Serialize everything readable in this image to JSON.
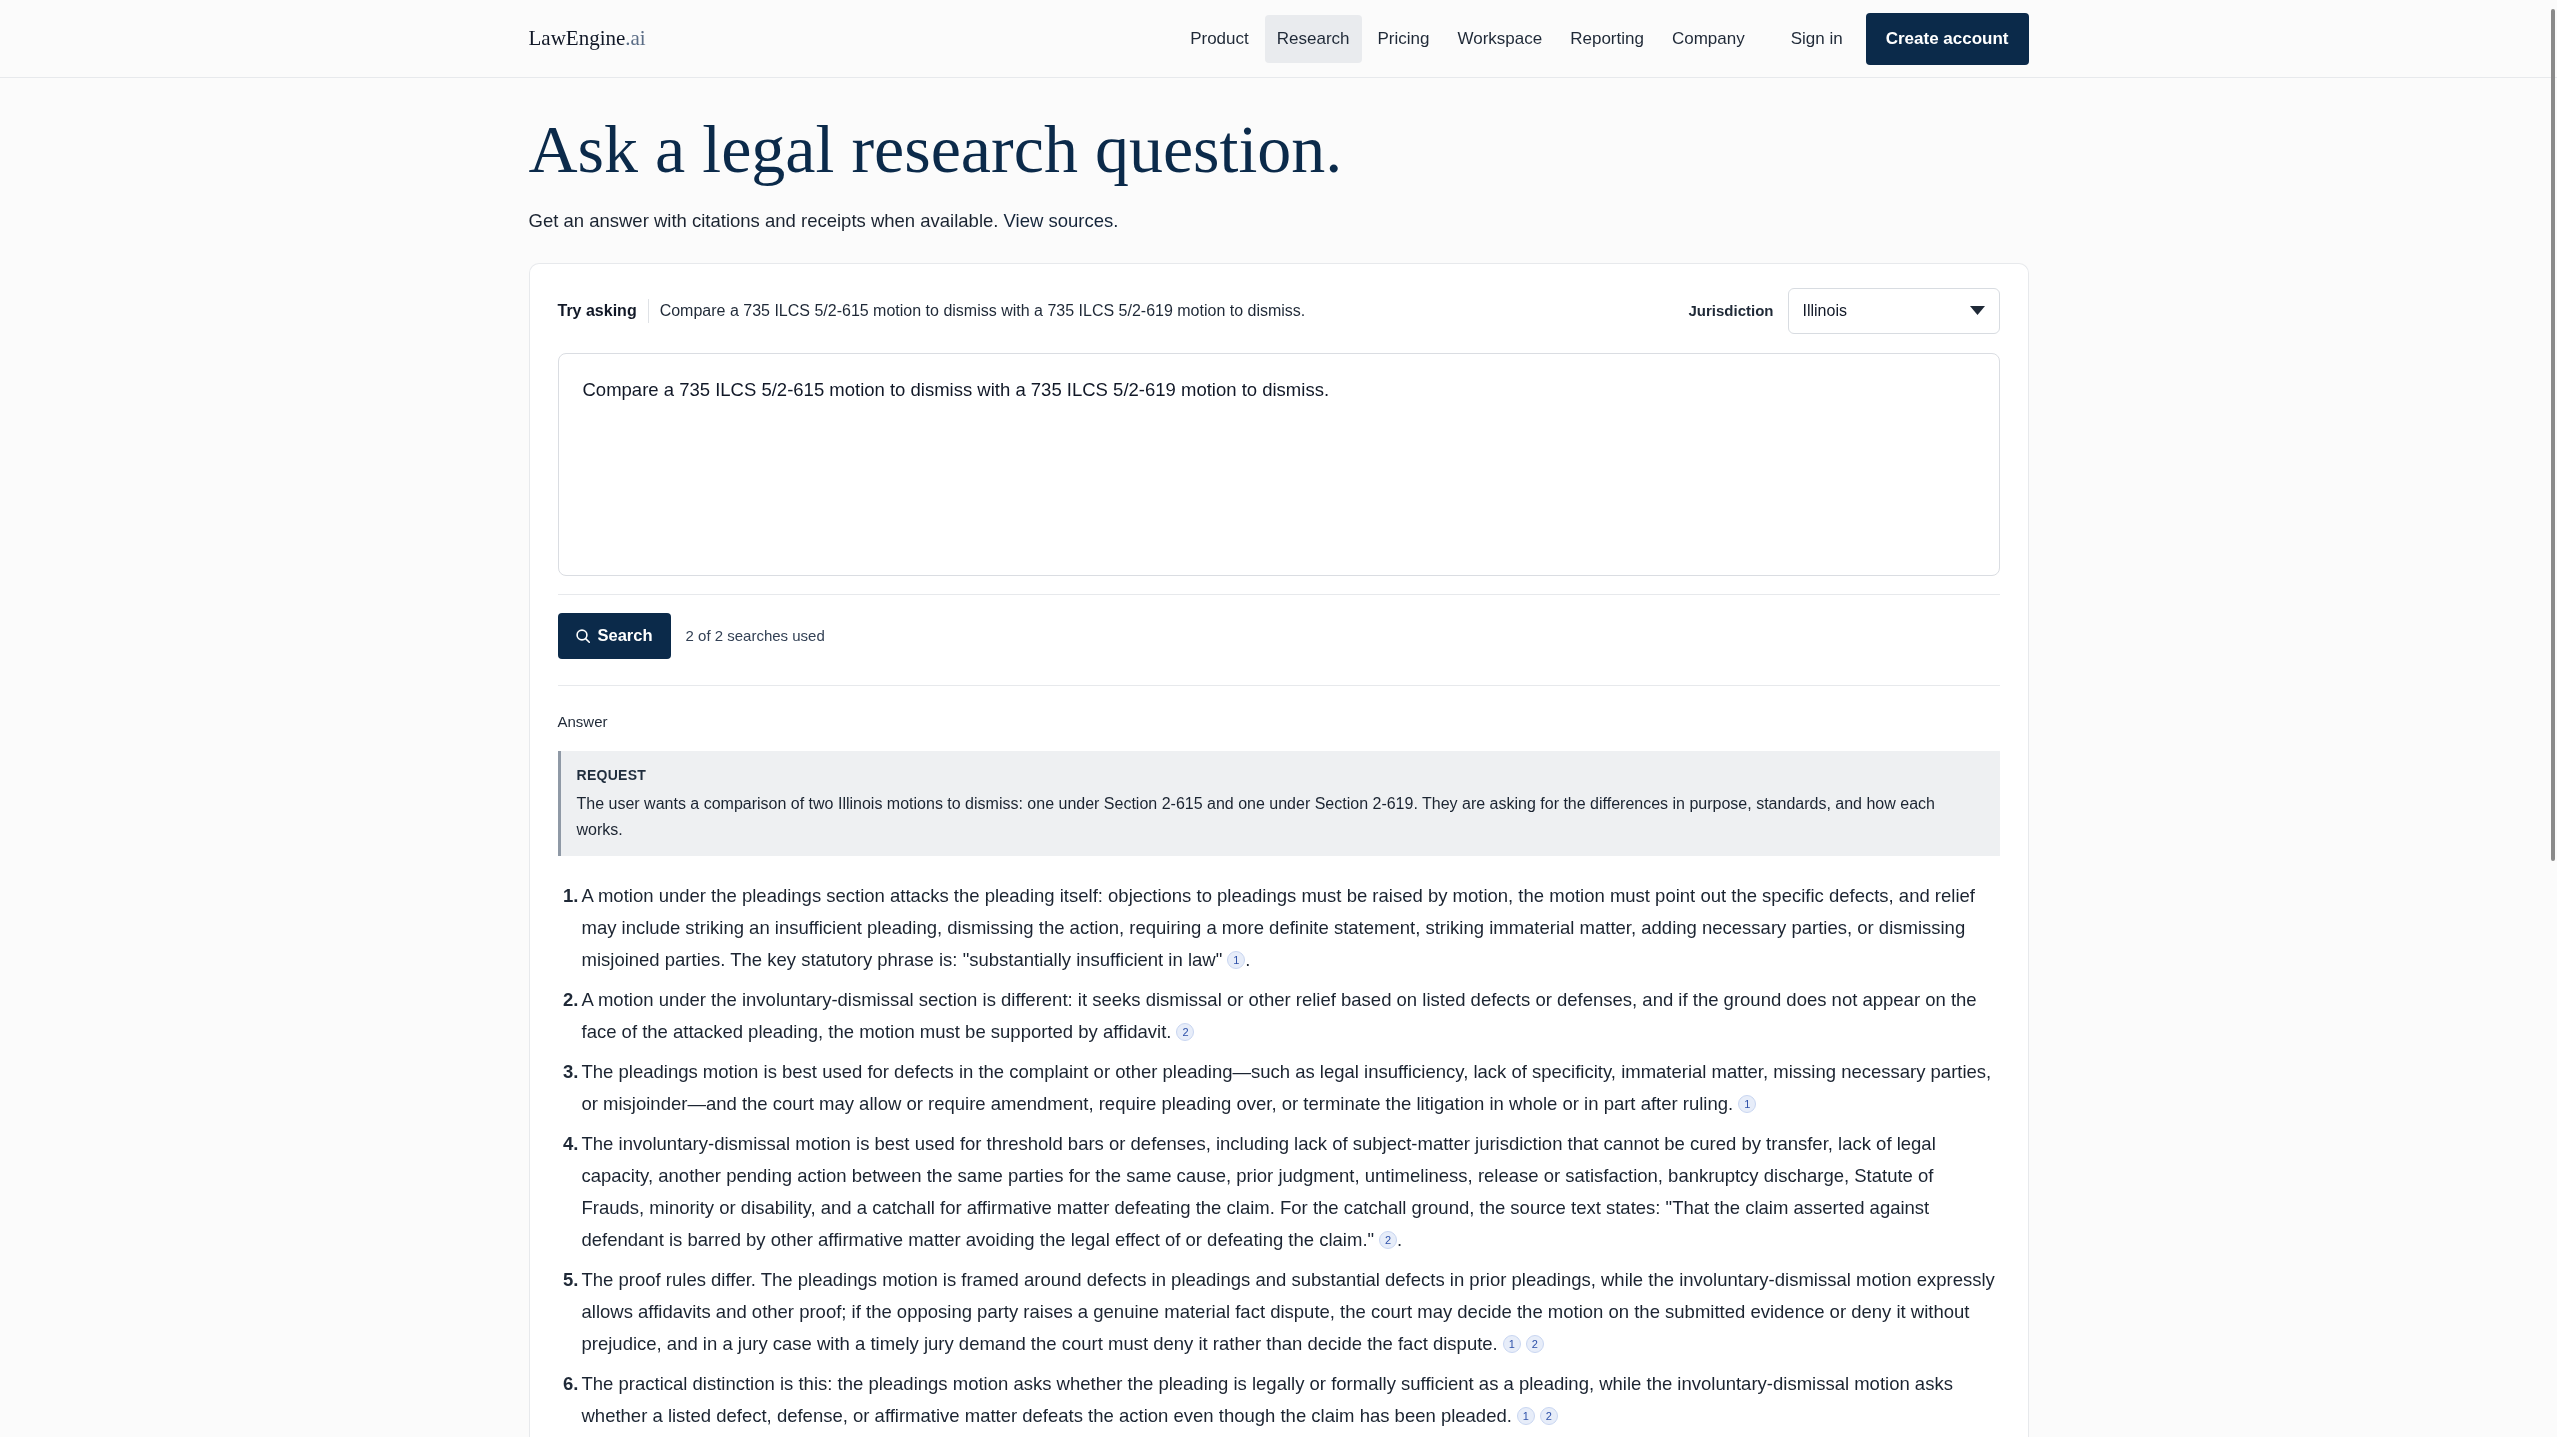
{
  "header": {
    "logo": {
      "name": "LawEngine",
      "suffix": ".ai"
    },
    "nav": [
      {
        "label": "Product",
        "selected": false
      },
      {
        "label": "Research",
        "selected": true
      },
      {
        "label": "Pricing",
        "selected": false
      },
      {
        "label": "Workspace",
        "selected": false
      },
      {
        "label": "Reporting",
        "selected": false
      },
      {
        "label": "Company",
        "selected": false
      }
    ],
    "sign_in": "Sign in",
    "create_account": "Create account"
  },
  "hero": {
    "title": "Ask a legal research question.",
    "subtitle": "Get an answer with citations and receipts when available.",
    "subtitle_link": "View sources."
  },
  "research": {
    "try_asking_label": "Try asking",
    "suggestion": "Compare a 735 ILCS 5/2-615 motion to dismiss with a 735 ILCS 5/2-619 motion to dismiss.",
    "jurisdiction_label": "Jurisdiction",
    "jurisdiction": "Illinois",
    "question": "Compare a 735 ILCS 5/2-615 motion to dismiss with a 735 ILCS 5/2-619 motion to dismiss.",
    "search_button": "Search",
    "usage": "2 of 2 searches used"
  },
  "answer": {
    "label": "Answer",
    "request": {
      "heading": "REQUEST",
      "text": "The user wants a comparison of two Illinois motions to dismiss: one under Section 2-615 and one under Section 2-619. They are asking for the differences in purpose, standards, and how each works."
    },
    "items": [
      {
        "number": "1.",
        "text": "A motion under the pleadings section attacks the pleading itself: objections to pleadings must be raised by motion, the motion must point out the specific defects, and relief may include striking an insufficient pleading, dismissing the action, requiring a more definite statement, striking immaterial matter, adding necessary parties, or dismissing misjoined parties. The key statutory phrase is: \"substantially insufficient in law\"",
        "citations": [
          "1"
        ],
        "trailing": "."
      },
      {
        "number": "2.",
        "text": "A motion under the involuntary-dismissal section is different: it seeks dismissal or other relief based on listed defects or defenses, and if the ground does not appear on the face of the attacked pleading, the motion must be supported by affidavit.",
        "citations": [
          "2"
        ]
      },
      {
        "number": "3.",
        "text": "The pleadings motion is best used for defects in the complaint or other pleading—such as legal insufficiency, lack of specificity, immaterial matter, missing necessary parties, or misjoinder—and the court may allow or require amendment, require pleading over, or terminate the litigation in whole or in part after ruling.",
        "citations": [
          "1"
        ]
      },
      {
        "number": "4.",
        "text": "The involuntary-dismissal motion is best used for threshold bars or defenses, including lack of subject-matter jurisdiction that cannot be cured by transfer, lack of legal capacity, another pending action between the same parties for the same cause, prior judgment, untimeliness, release or satisfaction, bankruptcy discharge, Statute of Frauds, minority or disability, and a catchall for affirmative matter defeating the claim. For the catchall ground, the source text states: \"That the claim asserted against defendant is barred by other affirmative matter avoiding the legal effect of or defeating the claim.\"",
        "citations": [
          "2"
        ],
        "trailing": "."
      },
      {
        "number": "5.",
        "text": "The proof rules differ. The pleadings motion is framed around defects in pleadings and substantial defects in prior pleadings, while the involuntary-dismissal motion expressly allows affidavits and other proof; if the opposing party raises a genuine material fact dispute, the court may decide the motion on the submitted evidence or deny it without prejudice, and in a jury case with a timely jury demand the court must deny it rather than decide the fact dispute.",
        "citations": [
          "1",
          "2"
        ]
      },
      {
        "number": "6.",
        "text": "The practical distinction is this: the pleadings motion asks whether the pleading is legally or formally sufficient as a pleading, while the involuntary-dismissal motion asks whether a listed defect, defense, or affirmative matter defeats the action even though the claim has been pleaded.",
        "citations": [
          "1",
          "2"
        ]
      }
    ]
  }
}
